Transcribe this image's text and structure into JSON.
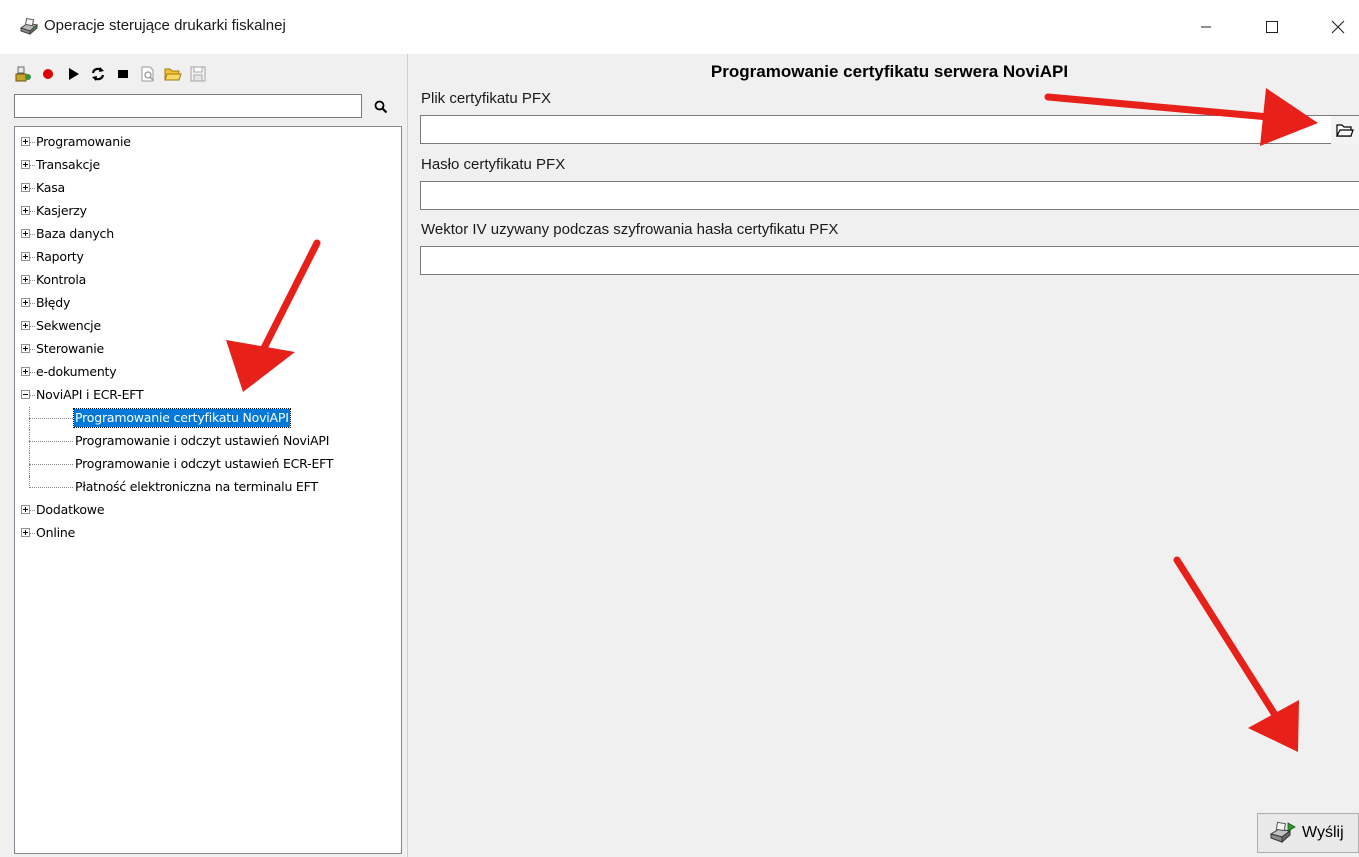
{
  "window": {
    "title": "Operacje sterujące drukarki fiskalnej",
    "controls": [
      "minimize",
      "maximize",
      "close"
    ]
  },
  "toolbar": {
    "buttons": [
      "run-all-icon",
      "record-icon",
      "play-icon",
      "loop-icon",
      "stop-icon",
      "preview-icon",
      "open-folder-icon",
      "save-icon"
    ]
  },
  "search": {
    "value": "",
    "placeholder": ""
  },
  "tree": {
    "items": [
      {
        "label": "Programowanie",
        "expanded": false
      },
      {
        "label": "Transakcje",
        "expanded": false
      },
      {
        "label": "Kasa",
        "expanded": false
      },
      {
        "label": "Kasjerzy",
        "expanded": false
      },
      {
        "label": "Baza danych",
        "expanded": false
      },
      {
        "label": "Raporty",
        "expanded": false
      },
      {
        "label": "Kontrola",
        "expanded": false
      },
      {
        "label": "Błędy",
        "expanded": false
      },
      {
        "label": "Sekwencje",
        "expanded": false
      },
      {
        "label": "Sterowanie",
        "expanded": false
      },
      {
        "label": "e-dokumenty",
        "expanded": false
      },
      {
        "label": "NoviAPI i ECR-EFT",
        "expanded": true,
        "children": [
          {
            "label": "Programowanie certyfikatu NoviAPI",
            "selected": true
          },
          {
            "label": "Programowanie i odczyt ustawień NoviAPI"
          },
          {
            "label": "Programowanie i odczyt ustawień ECR-EFT"
          },
          {
            "label": "Płatność elektroniczna na terminalu EFT"
          }
        ]
      },
      {
        "label": "Dodatkowe",
        "expanded": false
      },
      {
        "label": "Online",
        "expanded": false
      }
    ]
  },
  "panel": {
    "title": "Programowanie certyfikatu serwera NoviAPI",
    "fields": [
      {
        "label": "Plik certyfikatu PFX",
        "value": "",
        "has_browse": true
      },
      {
        "label": "Hasło certyfikatu PFX",
        "value": ""
      },
      {
        "label": "Wektor IV uzywany podczas szyfrowania hasła certyfikatu PFX",
        "value": ""
      }
    ],
    "send_label": "Wyślij"
  },
  "colors": {
    "selection": "#0078d7",
    "annotation_arrow": "#e8201a"
  }
}
